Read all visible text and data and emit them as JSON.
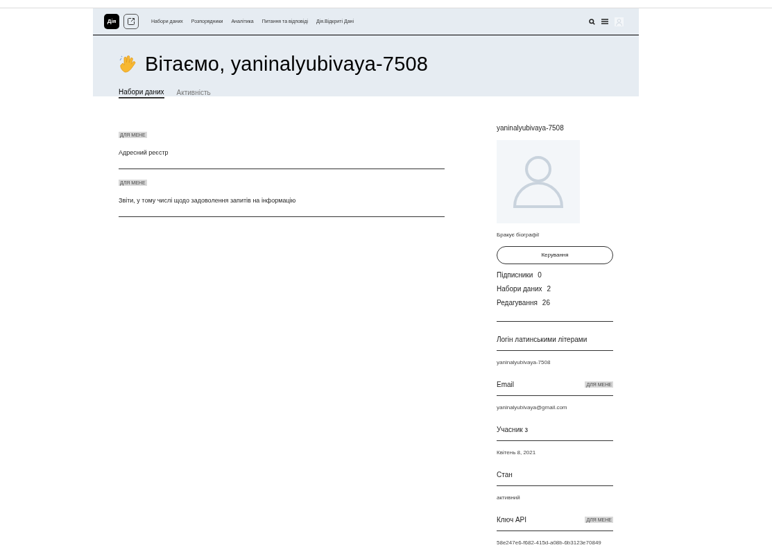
{
  "logo": "Дія",
  "nav": [
    "Набори даних",
    "Розпорядники",
    "Аналітика",
    "Питання та відповіді",
    "Дія.Відкриті Дані"
  ],
  "greeting": "Вітаємо, yaninalyubivaya-7508",
  "tabs": [
    {
      "label": "Набори даних",
      "selected": true
    },
    {
      "label": "Активність",
      "selected": false
    }
  ],
  "datasets": [
    {
      "badge": "ДЛЯ МЕНЕ",
      "title": "Адресний реєстр"
    },
    {
      "badge": "ДЛЯ МЕНЕ",
      "title": "Звіти, у тому числі щодо задоволення запитів на інформацію"
    }
  ],
  "profile": {
    "username": "yaninalyubivaya-7508",
    "bio": "Бракує біографії",
    "manage_button": "Керування",
    "stats": [
      {
        "label": "Підписники",
        "value": "0"
      },
      {
        "label": "Набори даних",
        "value": "2"
      },
      {
        "label": "Редагування",
        "value": "26"
      }
    ],
    "fields": [
      {
        "label": "Логін латинськими літерами",
        "value": "yaninalyubivaya-7508"
      },
      {
        "label": "Email",
        "badge": "ДЛЯ МЕНЕ",
        "value": "yaninalyubivaya@gmail.com"
      },
      {
        "label": "Учасник з",
        "value": "Квітень 8, 2021"
      },
      {
        "label": "Стан",
        "value": "активний"
      },
      {
        "label": "Ключ API",
        "badge": "ДЛЯ МЕНЕ",
        "value": "58e247e6-f682-415d-a08b-6b3123e70849"
      }
    ]
  }
}
